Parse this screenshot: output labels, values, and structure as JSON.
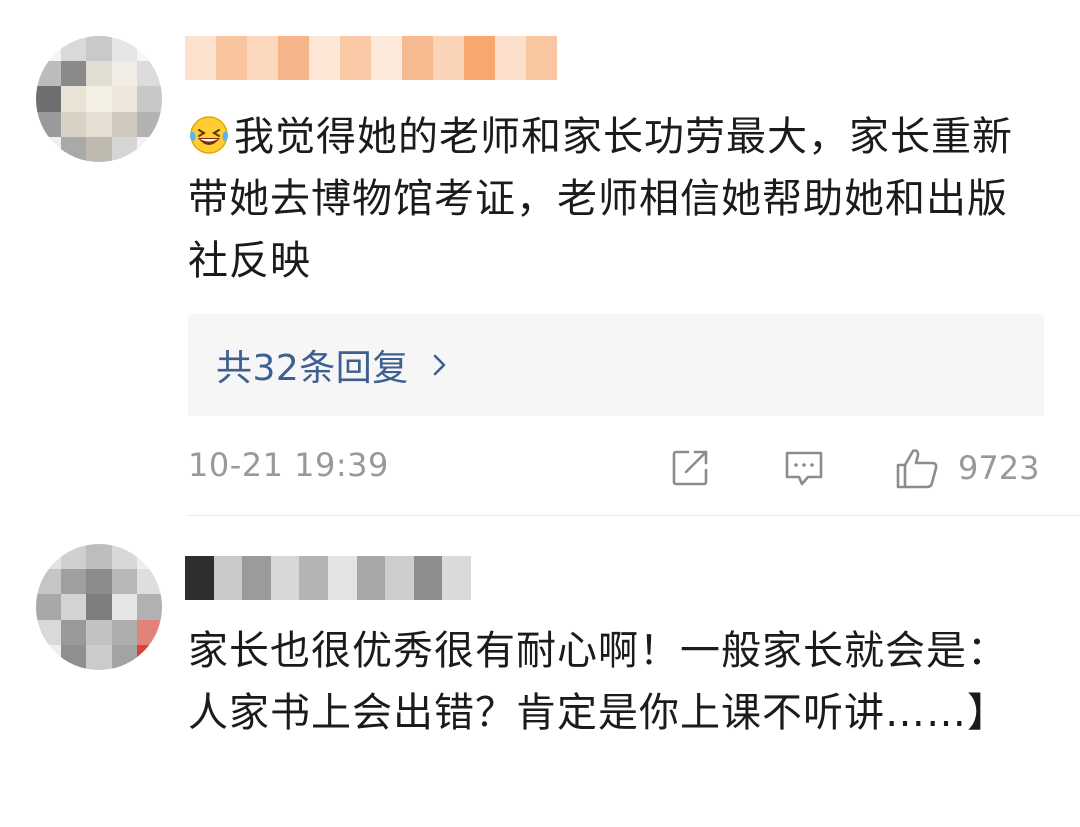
{
  "comments": [
    {
      "text": "我觉得她的老师和家长功劳最大，家长重新带她去博物馆考证，老师相信她帮助她和出版社反映",
      "emoji_icon": "grinning-squinting-tears-emoji",
      "replies_label": "共32条回复",
      "timestamp": "10-21 19:39",
      "likes": "9723",
      "icons": [
        "share-icon",
        "comment-icon",
        "thumbs-up-icon"
      ]
    },
    {
      "text": "家长也很优秀很有耐心啊！一般家长就会是：人家书上会出错？肯定是你上课不听讲……】"
    }
  ],
  "colors": {
    "reply_link": "#3e5f8f",
    "meta_text": "#999999",
    "reply_box_bg": "#f6f6f6",
    "divider": "#e9e9e9"
  }
}
